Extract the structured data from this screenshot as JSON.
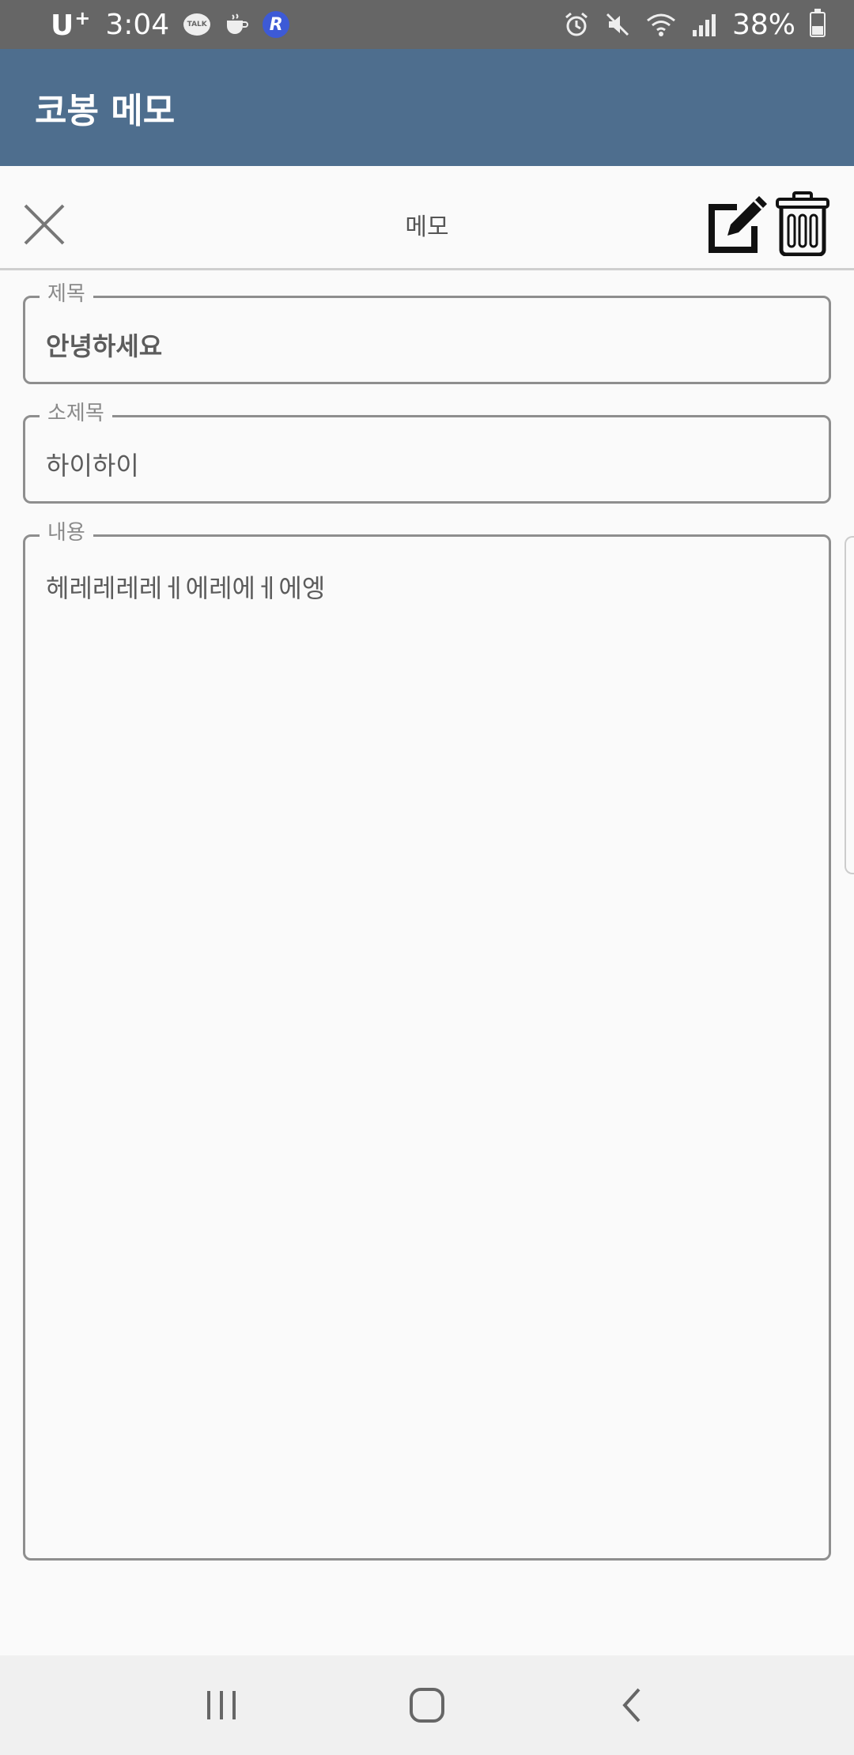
{
  "status_bar": {
    "carrier": "U",
    "carrier_plus": "+",
    "time": "3:04",
    "talk_badge": "TALK",
    "r_badge": "R",
    "battery": "38%",
    "battery_level": 0.38
  },
  "app_bar": {
    "title": "코봉 메모"
  },
  "toolbar": {
    "title": "메모"
  },
  "fields": {
    "title": {
      "label": "제목",
      "value": "안녕하세요"
    },
    "subtitle": {
      "label": "소제목",
      "value": "하이하이"
    },
    "content": {
      "label": "내용",
      "value": "헤레레레레ㅔ에레에ㅔ에엥"
    }
  },
  "icons": {
    "close": "close-icon",
    "edit": "edit-icon",
    "delete": "trash-icon",
    "recents": "recent-apps-icon",
    "home": "home-icon",
    "back": "back-icon"
  },
  "colors": {
    "app_bar": "#4e6e8e",
    "status_bar": "#666666",
    "background": "#fafafa"
  }
}
